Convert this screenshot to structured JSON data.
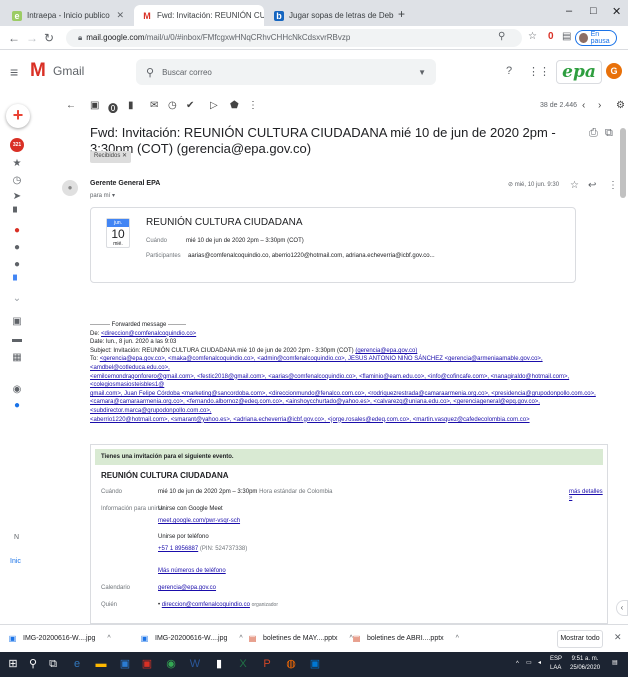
{
  "browser": {
    "tabs": [
      {
        "label": "Intraepa - Inicio publico",
        "active": false
      },
      {
        "label": "Fwd: Invitación: REUNIÓN CULTU",
        "active": true
      },
      {
        "label": "Jugar sopas de letras de Deberes",
        "active": false
      }
    ],
    "url_host": "mail.google.com",
    "url_path": "/mail/u/0/#inbox/FMfcgxwHNqCRhvCHHcNkCdsxvrRBvzp",
    "profile_status": "En pausa",
    "extension_badge": "0"
  },
  "gmail": {
    "app_name": "Gmail",
    "search_placeholder": "Buscar correo",
    "account_initial": "G",
    "org_logo_text": "epa",
    "unread_badge": "321",
    "pager": "38 de 2.446",
    "rail_n": "N",
    "rail_inic": "Inic"
  },
  "message": {
    "subject": "Fwd: Invitación: REUNIÓN CULTURA CIUDADANA mié 10 de jun de 2020 2pm - 3:30pm (COT) (gerencia@epa.gov.co)",
    "label": "Recibidos",
    "sender": "Gerente General EPA",
    "to": "para mí",
    "date": "mié, 10 jun. 9:30",
    "card": {
      "month": "jun.",
      "day": "10",
      "weekday": "mié.",
      "title": "REUNIÓN CULTURA CIUDADANA",
      "when_label": "Cuándo",
      "when": "mié 10 de jun de 2020 2pm – 3:30pm (COT)",
      "participants_label": "Participantes",
      "participants": "aarias@comfenalcoquindio.co, aberrio1220@hotmail.com, adriana.echeverria@icbf.gov.co..."
    },
    "forward": {
      "header": "---------- Forwarded message ---------",
      "from_label": "De:",
      "from": "<direccion@comfenalcoquindio.co>",
      "date_line": "Date: lun., 8 jun. 2020 a las 9:03",
      "subject_line": "Subject: Invitación: REUNIÓN CULTURA CIUDADANA mié 10 de jun de 2020 2pm - 3:30pm (COT)",
      "subject_email": "(gerencia@epa.gov.co)",
      "to_label": "To:",
      "recipients_1": "<gerencia@epa.gov.co>, <maka@comfenalcoquindio.co>, <admin@comfenalcoquindio.co>, JESUS ANTONIO NIÑO SÁNCHEZ <gerencia@armeniaamable.gov.co>, <amdbel@cotleduca.edu.co>,",
      "recipients_2": "<emilcemondragonforero@gmail.com>, <festic2018@gmail.com>, <aarias@comfenalcoquindio.co>, <flaminio@eam.edu.co>, <info@cofincafe.com>, <nanagiraldo@hotmail.com>, <colegiosmasiosteisbles1@",
      "recipients_3": "gmail.com>, Juan Felipe Córdoba <marketing@sancordoba.com>, <direccionmundo@fenalco.com.co>, <rodriquezrestrada@camaraarmenia.org.co>, <presidencia@grupodonpollo.com.co>,",
      "recipients_4": "<camara@camaraarmenia.org.co>, <fernando.albornoz@edeq.com.co>, <ainshoycchurtado@yahoo.es>, <calvarezq@uniana.edu.co>, <gerenciageneral@epq.gov.co>, <subdirector.marca@grupodonpollo.com.co>,",
      "recipients_5": "<aberrio1220@hotmail.com>, <smarant@yahoo.es>, <adriana.echeverria@icbf.gov.co>, <jorge.rosales@edeq.com.co>, <martin.vasquez@cafedecolombia.com.co>"
    },
    "invite": {
      "banner": "Tienes una invitación para el siguiente evento.",
      "title": "REUNIÓN CULTURA CIUDADANA",
      "more": "más detalles »",
      "when_label": "Cuándo",
      "when": "mié 10 de jun de 2020 2pm – 3:30pm",
      "when_tz": "Hora estándar de Colombia",
      "join_label": "Información para unirse",
      "join_meet": "Unirse con Google Meet",
      "meet_link": "meet.google.com/pwr-vsqr-sch",
      "join_phone": "Unirse por teléfono",
      "phone": "+57 1 8956887",
      "pin": "(PIN: 524737338)",
      "more_numbers": "Más números de teléfono",
      "calendar_label": "Calendario",
      "calendar": "gerencia@epa.gov.co",
      "who_label": "Quién",
      "who_first": "direccion@comfenalcoquindio.co",
      "who_role": "organizador"
    }
  },
  "downloads": [
    {
      "label": "IMG-20200616-W....jpg"
    },
    {
      "label": "IMG-20200616-W....jpg"
    },
    {
      "label": "boletines de MAY....pptx"
    },
    {
      "label": "boletines de ABRI....pptx"
    }
  ],
  "downloads_show_all": "Mostrar todo",
  "system": {
    "lang": "ESP",
    "lang2": "LAA",
    "time": "9:51 a. m.",
    "date": "25/06/2020"
  },
  "colors": {
    "gmail_red": "#d93025",
    "link_blue": "#1a0dab",
    "banner_green": "#d9ead3",
    "taskbar": "#1c2432"
  }
}
